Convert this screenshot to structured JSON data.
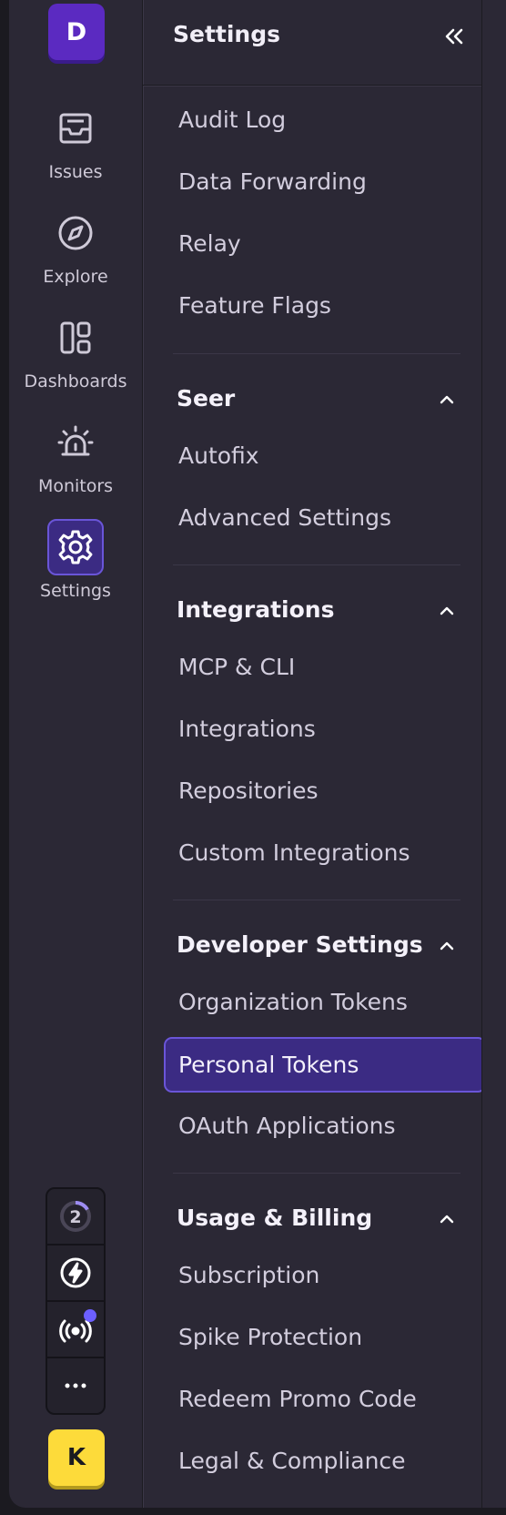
{
  "org": {
    "initial": "D"
  },
  "user": {
    "initial": "K"
  },
  "nav": [
    {
      "label": "Issues",
      "icon": "inbox-icon"
    },
    {
      "label": "Explore",
      "icon": "compass-icon"
    },
    {
      "label": "Dashboards",
      "icon": "dashboard-icon"
    },
    {
      "label": "Monitors",
      "icon": "siren-icon"
    },
    {
      "label": "Settings",
      "icon": "gear-icon",
      "active": true
    }
  ],
  "tools": {
    "onboarding_count": "2",
    "items": [
      "onboarding-progress-icon",
      "whats-new-icon",
      "broadcast-icon",
      "more-icon"
    ]
  },
  "panel": {
    "title": "Settings",
    "collapse_icon": "double-chevron-left-icon"
  },
  "menu": {
    "top_links": [
      "Audit Log",
      "Data Forwarding",
      "Relay",
      "Feature Flags"
    ],
    "sections": [
      {
        "title": "Seer",
        "links": [
          "Autofix",
          "Advanced Settings"
        ]
      },
      {
        "title": "Integrations",
        "links": [
          "MCP & CLI",
          "Integrations",
          "Repositories",
          "Custom Integrations"
        ]
      },
      {
        "title": "Developer Settings",
        "links": [
          "Organization Tokens",
          "Personal Tokens",
          "OAuth Applications"
        ],
        "selected": "Personal Tokens"
      },
      {
        "title": "Usage & Billing",
        "links": [
          "Subscription",
          "Spike Protection",
          "Redeem Promo Code",
          "Legal & Compliance"
        ]
      }
    ]
  },
  "colors": {
    "background": "#2b2835",
    "accent": "#6a55d8",
    "selected_bg": "#3b2b83",
    "org_avatar": "#5b2ac1",
    "user_avatar": "#fddb3a"
  }
}
